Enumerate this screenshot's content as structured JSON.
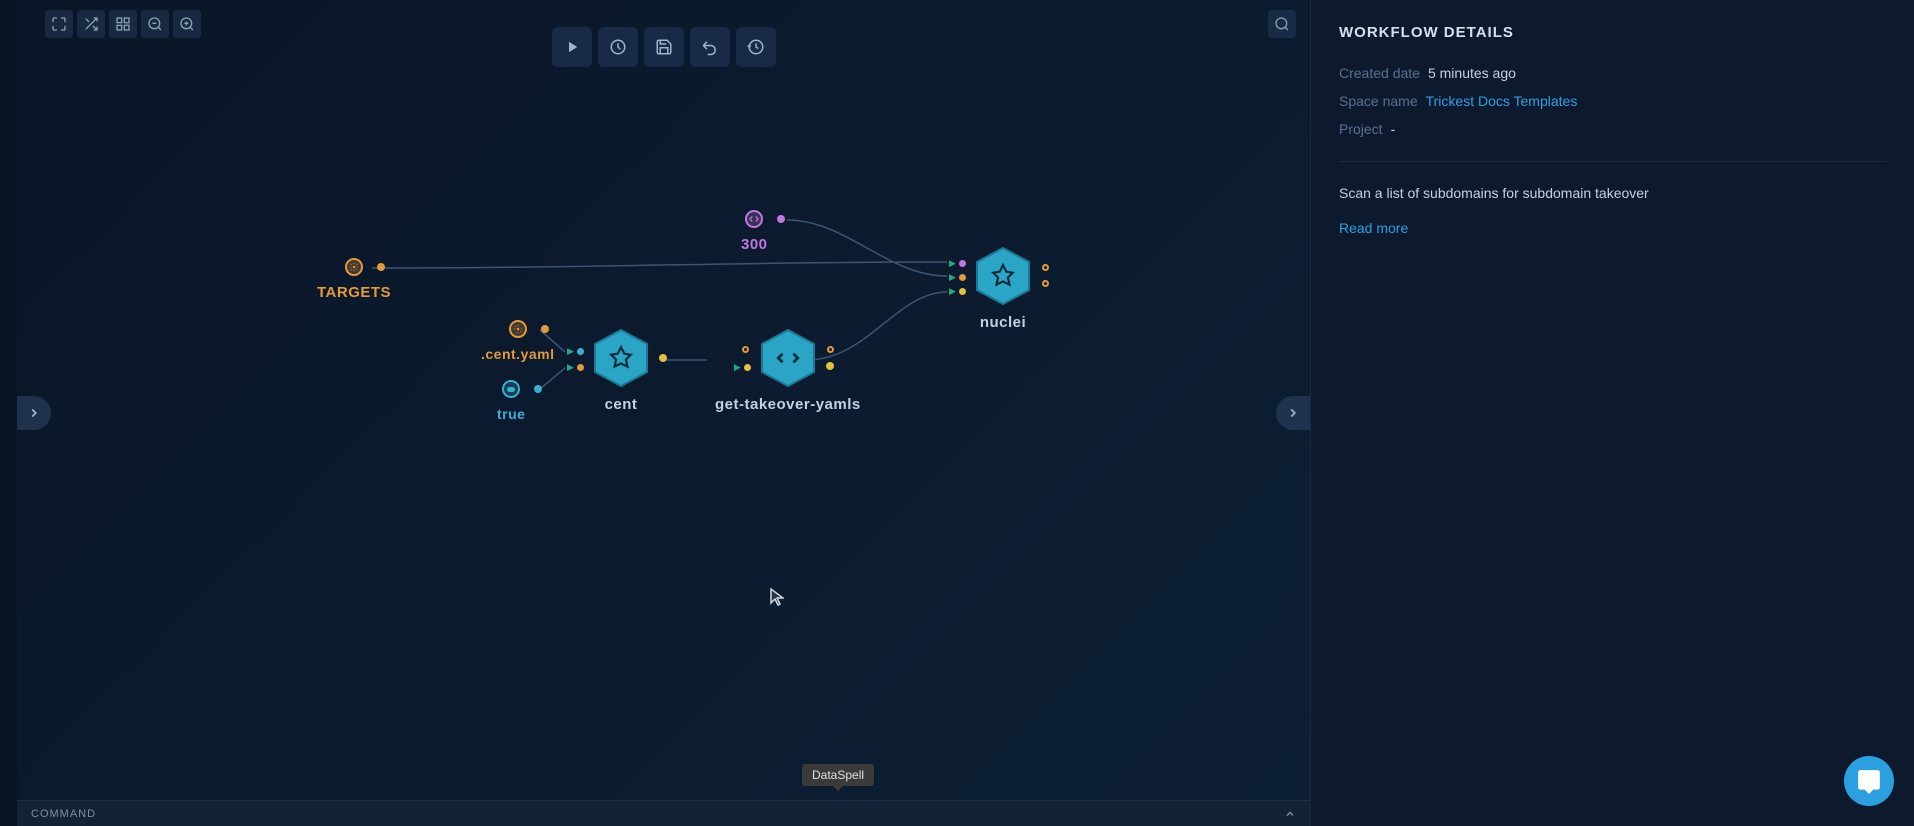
{
  "sidebar": {
    "title": "WORKFLOW DETAILS",
    "created_label": "Created date",
    "created_value": "5 minutes ago",
    "space_label": "Space name",
    "space_value": "Trickest Docs Templates",
    "project_label": "Project",
    "project_value": "-",
    "description": "Scan a list of subdomains for subdomain takeover",
    "readmore": "Read more"
  },
  "nodes": {
    "targets": "TARGETS",
    "n300": "300",
    "cent_yaml": ".cent.yaml",
    "true_val": "true",
    "cent": "cent",
    "get_takeover": "get-takeover-yamls",
    "nuclei": "nuclei"
  },
  "command_bar": "COMMAND",
  "tooltip": "DataSpell"
}
